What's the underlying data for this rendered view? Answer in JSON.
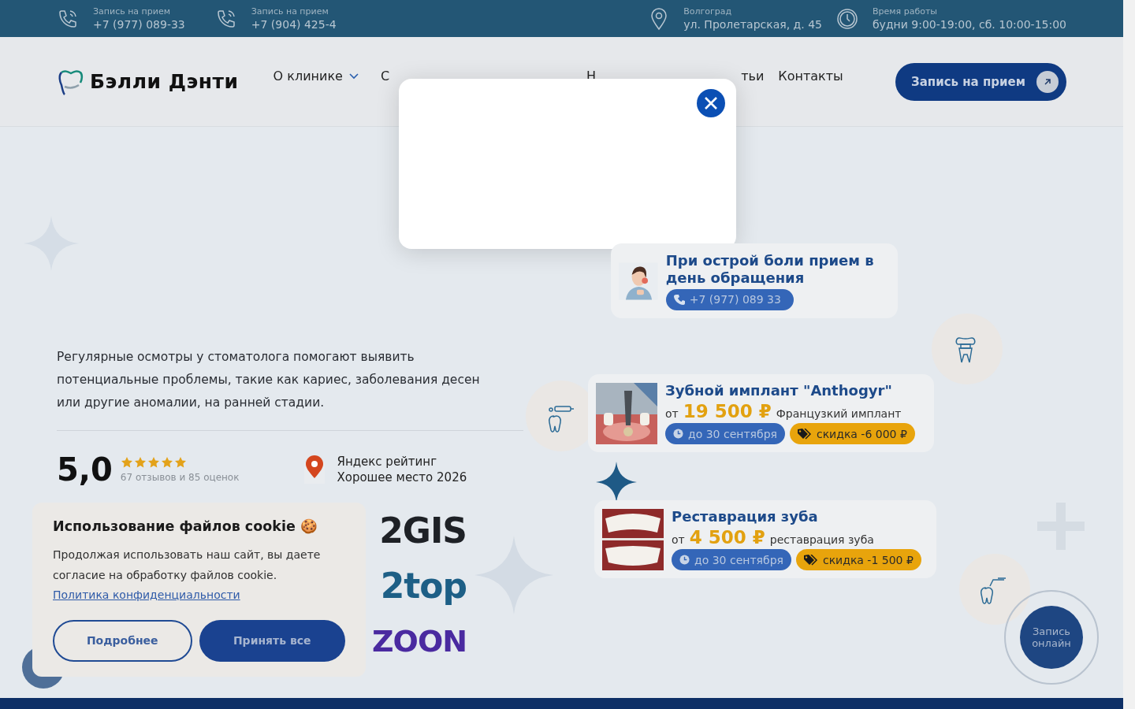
{
  "top_bar": {
    "contacts": [
      {
        "kind": "phone",
        "label": "Запись на прием",
        "value": "+7 (977) 089-33"
      },
      {
        "kind": "phone",
        "label": "Запись на прием",
        "value": "+7 (904) 425-4"
      },
      {
        "kind": "address",
        "label": "Волгоград",
        "value": "ул. Пролетарская, д. 45"
      },
      {
        "kind": "hours",
        "label": "Время работы",
        "value": "будни 9:00-19:00, сб. 10:00-15:00"
      }
    ]
  },
  "header": {
    "logo": "Бэлли Дэнти",
    "nav": [
      {
        "label": "О клинике",
        "dropdown": true
      },
      {
        "label": "С",
        "dropdown": false
      },
      {
        "label": "Н",
        "dropdown": false
      },
      {
        "label": "тьи",
        "dropdown": false
      },
      {
        "label": "Контакты",
        "dropdown": false
      }
    ],
    "cta": "Запись на прием"
  },
  "hero": {
    "description": "Регулярные осмотры у стоматолога помогают выявить потенциальные проблемы, такие как кариес, заболевания десен или другие аномалии, на ранней стадии.",
    "rating": {
      "score": "5,0",
      "stars": 5,
      "reviews": "67 отзывов и 85 оценок"
    },
    "yandex": {
      "title": "Яндекс рейтинг",
      "subtitle": "Хорошее место 2026"
    },
    "partner_logos": [
      {
        "kind": "gis",
        "text": "2GIS"
      },
      {
        "kind": "top",
        "text": "2top"
      },
      {
        "kind": "zoon",
        "text": "ZOON"
      }
    ]
  },
  "urgent_card": {
    "title": "При острой боли прием в день обращения",
    "phone": "+7 (977) 089 33"
  },
  "offers": [
    {
      "kind": "implant",
      "title": "Зубной имплант \"Anthogyr\"",
      "prefix": "от",
      "price": "19 500 ₽",
      "note": "Французкий имплант",
      "deadline": "до 30 сентября",
      "discount": "скидка -6 000 ₽"
    },
    {
      "kind": "smile",
      "title": "Реставрация зуба",
      "prefix": "от",
      "price": "4 500 ₽",
      "note": "реставрация зуба",
      "deadline": "до 30 сентября",
      "discount": "скидка -1 500 ₽"
    }
  ],
  "online_button": "Запись онлайн",
  "cookie_banner": {
    "title": "Использование файлов cookie 🍪",
    "text": "Продолжая использовать наш сайт, вы даете согласие на обработку файлов cookie.",
    "link": "Политика конфиденциальности",
    "buttons": [
      {
        "label": "Подробнее",
        "kind": "outline"
      },
      {
        "label": "Принять все",
        "kind": "primary"
      }
    ]
  }
}
